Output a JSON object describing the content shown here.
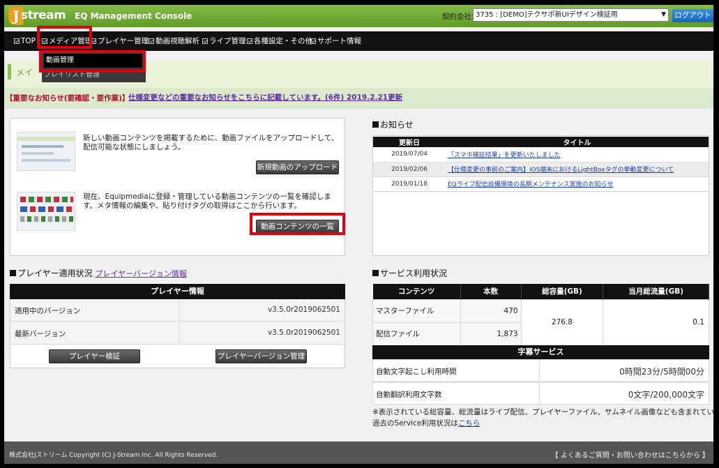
{
  "header": {
    "logo_text": "stream",
    "logo_initial": "J",
    "app_title": "EQ Management Console",
    "contract_label": "契約会社:",
    "contract_value": "3735 : [DEMO]テクサポ新UIデザイン検証用",
    "logout_label": "ログアウト"
  },
  "nav": {
    "items": [
      {
        "label": "TOP"
      },
      {
        "label": "メディア管理"
      },
      {
        "label": "プレイヤー管理"
      },
      {
        "label": "動画視聴解析"
      },
      {
        "label": "ライブ管理"
      },
      {
        "label": "各種設定・その他"
      },
      {
        "label": "サポート情報"
      }
    ],
    "dropdown": [
      {
        "label": "動画管理"
      },
      {
        "label": "プレイリスト管理"
      }
    ]
  },
  "banner": {
    "title": "メイ"
  },
  "notice": {
    "important": "【重要なお知らせ(要確認・要作業)】",
    "link": "仕様変更などの重要なお知らせをこちらに記載しています。(6件) 2019.2.21更新"
  },
  "upload": {
    "desc1": "新しい動画コンテンツを掲載するために、動画ファイルをアップロードして、配信可能な状態にしましょう。",
    "button1": "新規動画のアップロード",
    "desc2": "現在、Equipmediaに登録・管理している動画コンテンツの一覧を確認します。メタ情報の編集や、貼り付けタグの取得はここから行います。",
    "button2": "動画コンテンツの一覧"
  },
  "news": {
    "title": "お知らせ",
    "col_date": "更新日",
    "col_title": "タイトル",
    "rows": [
      {
        "date": "2019/07/04",
        "title": "「スマホ検証結果」を更新いたしました"
      },
      {
        "date": "2019/02/06",
        "title": "【仕様変更の事前のご案内】iOS端末におけるLightBoxタグの挙動変更について"
      },
      {
        "date": "2019/01/18",
        "title": "EQライブ配信設備環境の長期メンテナンス実施のお知らせ"
      }
    ]
  },
  "player": {
    "title": "プレイヤー適用状況",
    "version_link": "プレイヤーバージョン情報",
    "table_header": "プレイヤー情報",
    "rows": [
      {
        "key": "適用中のバージョン",
        "value": "v3.5.0r2019062501"
      },
      {
        "key": "最新バージョン",
        "value": "v3.5.0r2019062501"
      }
    ],
    "btn_verify": "プレイヤー検証",
    "btn_manage": "プレイヤーバージョン管理"
  },
  "usage": {
    "title": "サービス利用状況",
    "headers": [
      "コンテンツ",
      "本数",
      "総容量(GB)",
      "当月総流量(GB)"
    ],
    "rows": [
      {
        "content": "マスターファイル",
        "count": "470"
      },
      {
        "content": "配信ファイル",
        "count": "1,873"
      }
    ],
    "total_capacity": "276.8",
    "monthly_traffic": "0.1",
    "subtitle_header": "字幕サービス",
    "subtitle_rows": [
      {
        "key": "自動文字起こし利用時間",
        "value": "0時間23分/5時間00分"
      },
      {
        "key": "自動翻訳利用文字数",
        "value": "0文字/200,000文字"
      }
    ],
    "footnote": "※表示されている総容量、総流量はライブ配信、プレイヤーファイル、サムネイル画像なども含まれています。",
    "past_text": "過去のService利用状況は",
    "past_link": "こちら"
  },
  "footer": {
    "copyright": "株式会社Jストリーム Copyright (C) J-Stream Inc. All Rights Reserved.",
    "contact": "【 よくあるご質問・お問い合わせはこちらから 】"
  }
}
